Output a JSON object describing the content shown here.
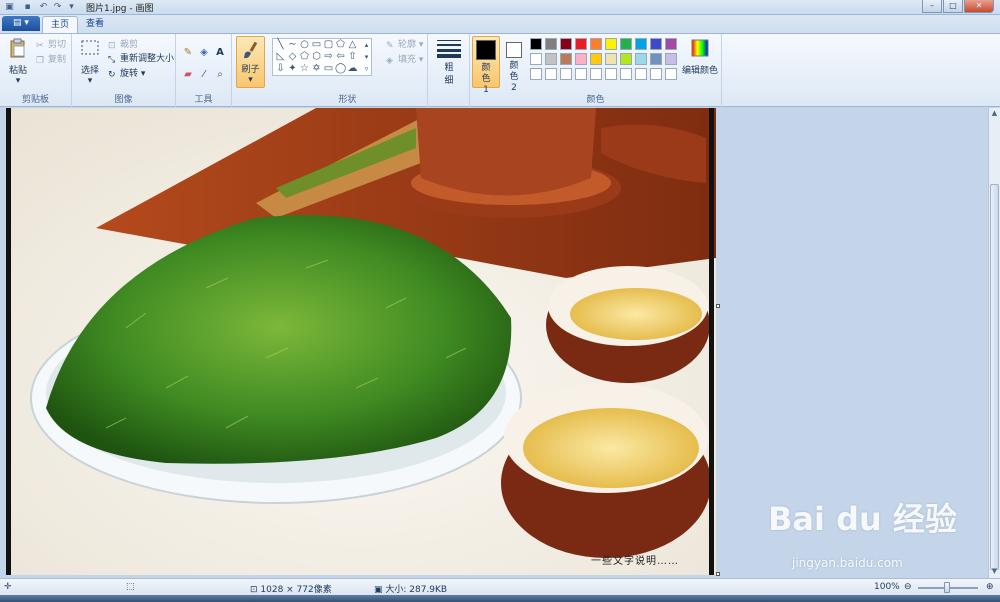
{
  "window": {
    "title": "图片1.jpg - 画图",
    "controls": {
      "minimize": "–",
      "maximize": "□",
      "close": "✕"
    }
  },
  "tabs": {
    "file": "▤ ▾",
    "home": "主页",
    "view": "查看"
  },
  "ribbon": {
    "clipboard": {
      "label": "剪贴板",
      "paste": "粘贴",
      "cut": "剪切",
      "copy": "复制"
    },
    "image": {
      "label": "图像",
      "select": "选择",
      "crop": "裁剪",
      "resize": "重新调整大小",
      "rotate": "旋转"
    },
    "tools": {
      "label": "工具"
    },
    "brush": {
      "label": "刷子"
    },
    "shapes": {
      "label": "形状",
      "outline": "轮廓",
      "fill": "填充"
    },
    "size": {
      "label_line1": "粗",
      "label_line2": "细"
    },
    "colors": {
      "label": "颜色",
      "color1": "颜色 1",
      "color2": "颜色 2",
      "edit": "编辑颜色",
      "color1_value": "#000000",
      "color2_value": "#ffffff",
      "palette": [
        "#000000",
        "#7f7f7f",
        "#880015",
        "#ed1c24",
        "#ff7f27",
        "#fff200",
        "#22b14c",
        "#00a2e8",
        "#3f48cc",
        "#a349a4",
        "#ffffff",
        "#c3c3c3",
        "#b97a57",
        "#ffaec9",
        "#ffc90e",
        "#efe4b0",
        "#b5e61d",
        "#99d9ea",
        "#7092be",
        "#c8bfe7",
        "#ffffff",
        "#ffffff",
        "#ffffff",
        "#ffffff",
        "#ffffff",
        "#ffffff",
        "#ffffff",
        "#ffffff",
        "#ffffff",
        "#ffffff"
      ]
    }
  },
  "canvas": {
    "caption": "一些文字说明……"
  },
  "status": {
    "dimensions": "1028 × 772像素",
    "size": "大小: 287.9KB",
    "zoom": "100%"
  },
  "watermark": {
    "brand": "Bai du 经验",
    "url": "jingyan.baidu.com"
  }
}
